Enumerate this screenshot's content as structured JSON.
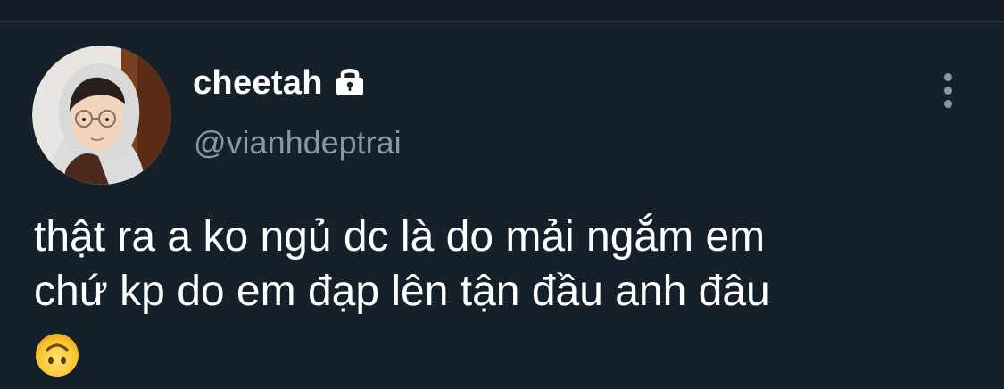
{
  "tweet": {
    "author": {
      "display_name": "cheetah",
      "handle": "@vianhdeptrai",
      "protected": true,
      "lock_icon": "lock-icon",
      "avatar_icon": "avatar"
    },
    "text_lines": [
      "thật ra a ko ngủ dc là do mải ngắm em",
      "chứ kp do em đạp lên tận đầu anh đâu"
    ],
    "emoji": "upside-down-face-emoji",
    "more_icon": "more-vertical-icon"
  },
  "colors": {
    "background": "#15202b",
    "text_primary": "#ffffff",
    "text_secondary": "#8899a6",
    "divider": "#2a3744"
  }
}
